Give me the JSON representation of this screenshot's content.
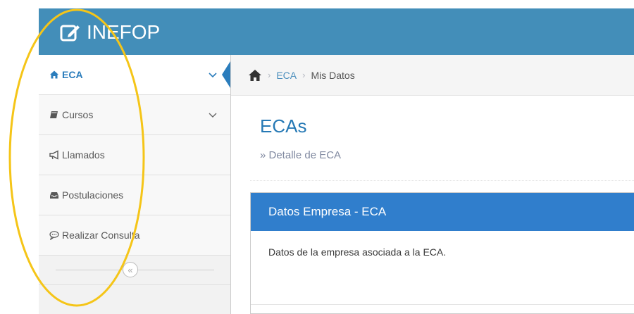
{
  "app": {
    "brand": "INEFOP"
  },
  "sidebar": {
    "items": [
      {
        "label": "ECA",
        "icon": "home-icon",
        "active": true,
        "has_submenu": true
      },
      {
        "label": "Cursos",
        "icon": "book-icon",
        "active": false,
        "has_submenu": true
      },
      {
        "label": "Llamados",
        "icon": "bullhorn-icon",
        "active": false,
        "has_submenu": false
      },
      {
        "label": "Postulaciones",
        "icon": "inbox-icon",
        "active": false,
        "has_submenu": false
      },
      {
        "label": "Realizar Consulta",
        "icon": "comment-icon",
        "active": false,
        "has_submenu": false
      }
    ],
    "collapse_glyph": "«"
  },
  "breadcrumb": {
    "items": [
      "ECA",
      "Mis Datos"
    ],
    "separator": "›"
  },
  "page": {
    "title": "ECAs",
    "subtitle": "» Detalle de ECA"
  },
  "widget": {
    "title": "Datos Empresa - ECA",
    "body": "Datos de la empresa asociada a la ECA."
  },
  "colors": {
    "navbar": "#438eb9",
    "accent": "#2b7dbc",
    "widget_header": "#307ecc",
    "annotation": "#f5c518"
  }
}
